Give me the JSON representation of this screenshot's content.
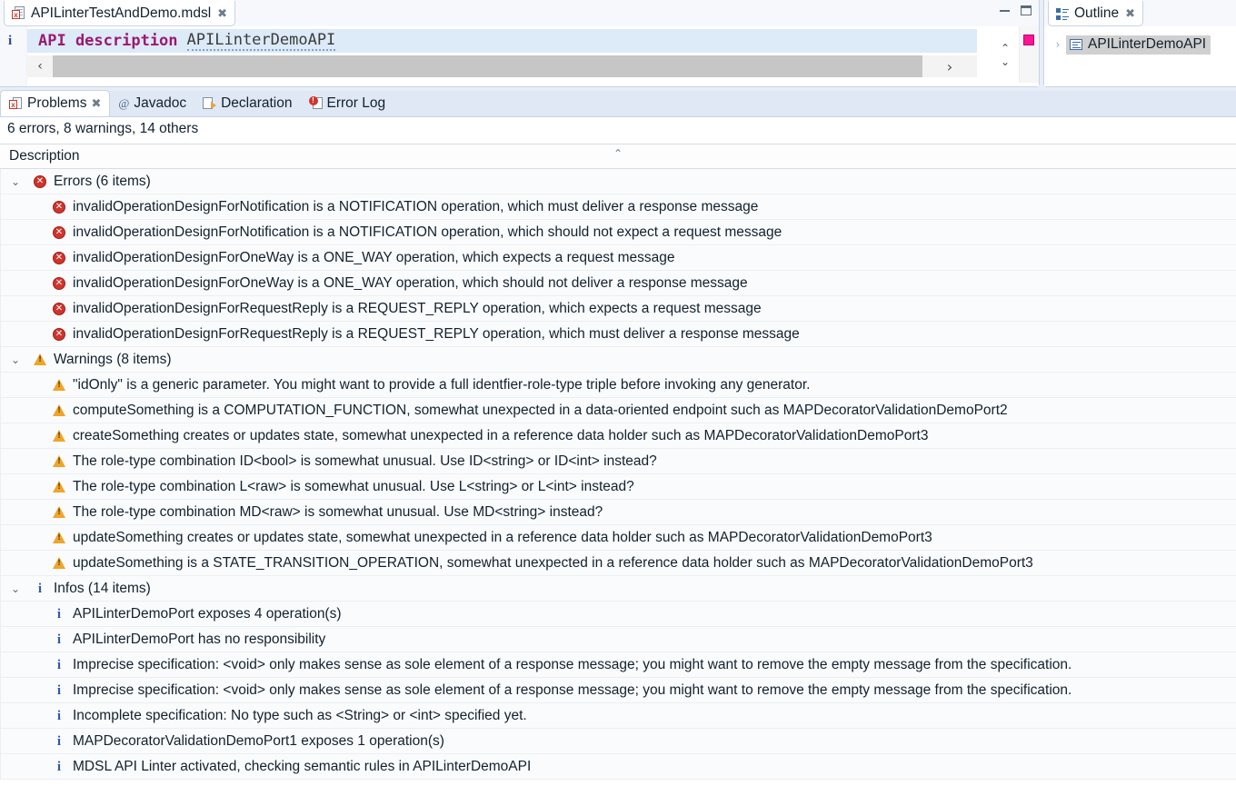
{
  "editor": {
    "tab": {
      "label": "APILinterTestAndDemo.mdsl",
      "close": "✖",
      "icon": "mdsl-file-icon"
    },
    "window_controls": {
      "minimize": "minimize-icon",
      "maximize": "maximize-icon"
    },
    "gutter_marker": "i",
    "code": {
      "keyword": "API description",
      "identifier": "APILinterDemoAPI"
    },
    "hscroll": {
      "left_arrow": "‹",
      "right_arrow": "›"
    },
    "vscroll": {
      "up_arrow": "⌃",
      "down_arrow": "⌄"
    },
    "marker_color": "#ff1493"
  },
  "outline": {
    "tab": {
      "label": "Outline",
      "close": "✖",
      "icon": "outline-icon"
    },
    "tree_arrow": "›",
    "root_item": "APILinterDemoAPI"
  },
  "problems": {
    "tabs": [
      {
        "label": "Problems",
        "icon": "problems-icon",
        "active": true,
        "close": "✖"
      },
      {
        "label": "Javadoc",
        "icon": "at-icon",
        "active": false
      },
      {
        "label": "Declaration",
        "icon": "declaration-icon",
        "active": false
      },
      {
        "label": "Error Log",
        "icon": "error-log-icon",
        "active": false
      }
    ],
    "summary": "6 errors, 8 warnings, 14 others",
    "column_header": "Description",
    "sort_indicator": "⌃",
    "expander_expanded": "⌄",
    "groups": [
      {
        "label": "Errors (6 items)",
        "severity": "error",
        "items": [
          "invalidOperationDesignForNotification is a NOTIFICATION operation, which must deliver a response message",
          "invalidOperationDesignForNotification is a NOTIFICATION operation, which should not expect a request message",
          "invalidOperationDesignForOneWay is a ONE_WAY operation, which expects a request message",
          "invalidOperationDesignForOneWay is a ONE_WAY operation, which should not deliver a response message",
          "invalidOperationDesignForRequestReply is a REQUEST_REPLY operation, which expects a request message",
          "invalidOperationDesignForRequestReply is a REQUEST_REPLY operation, which must deliver a response message"
        ]
      },
      {
        "label": "Warnings (8 items)",
        "severity": "warning",
        "items": [
          "\"idOnly\" is a generic parameter. You might want to provide a full identfier-role-type triple before invoking any generator.",
          "computeSomething is a COMPUTATION_FUNCTION, somewhat unexpected in a data-oriented endpoint such as MAPDecoratorValidationDemoPort2",
          "createSomething creates or updates state, somewhat unexpected in a reference data holder such as MAPDecoratorValidationDemoPort3",
          "The role-type combination ID<bool> is somewhat unusual. Use ID<string> or ID<int> instead?",
          "The role-type combination L<raw> is somewhat unusual. Use L<string> or L<int> instead?",
          "The role-type combination MD<raw> is somewhat unusual. Use MD<string> instead?",
          "updateSomething creates or updates state, somewhat unexpected in a reference data holder such as MAPDecoratorValidationDemoPort3",
          "updateSomething is a STATE_TRANSITION_OPERATION, somewhat unexpected in a reference data holder such as MAPDecoratorValidationDemoPort3"
        ]
      },
      {
        "label": "Infos (14 items)",
        "severity": "info",
        "items": [
          "APILinterDemoPort exposes 4 operation(s)",
          "APILinterDemoPort has no responsibility",
          "Imprecise specification: <void> only makes sense as sole element of a response message; you might want to remove the empty message from the specification.",
          "Imprecise specification: <void> only makes sense as sole element of a response message; you might want to remove the empty message from the specification.",
          "Incomplete specification: No type such as <String> or <int> specified yet.",
          "MAPDecoratorValidationDemoPort1 exposes 1 operation(s)",
          "MDSL API Linter activated, checking semantic rules in APILinterDemoAPI"
        ]
      }
    ]
  }
}
